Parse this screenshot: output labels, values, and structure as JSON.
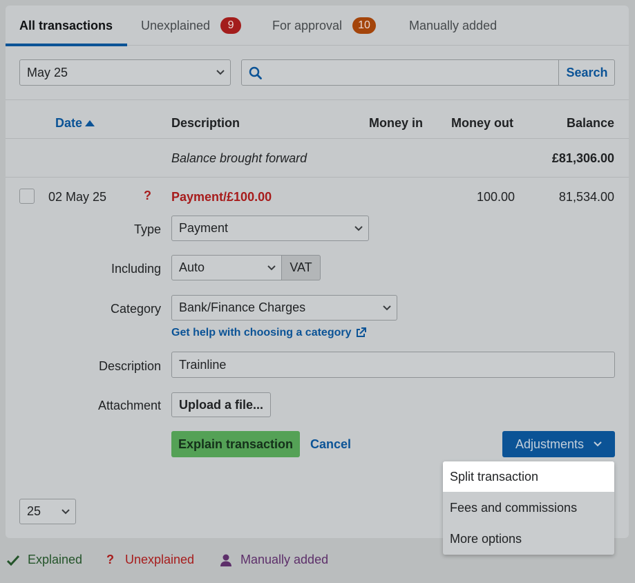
{
  "tabs": [
    {
      "label": "All transactions"
    },
    {
      "label": "Unexplained",
      "badge": "9"
    },
    {
      "label": "For approval",
      "badge": "10"
    },
    {
      "label": "Manually added"
    }
  ],
  "filters": {
    "month": "May 25",
    "search_value": "",
    "search_button": "Search"
  },
  "table": {
    "columns": {
      "date": "Date",
      "description": "Description",
      "money_in": "Money in",
      "money_out": "Money out",
      "balance": "Balance"
    },
    "brought_forward": {
      "description": "Balance brought forward",
      "balance": "£81,306.00"
    },
    "row": {
      "date": "02 May 25",
      "status_glyph": "?",
      "description": "Payment/£100.00",
      "money_out": "100.00",
      "balance": "81,534.00"
    }
  },
  "form": {
    "type_label": "Type",
    "type_value": "Payment",
    "including_label": "Including",
    "including_value": "Auto",
    "vat_label": "VAT",
    "category_label": "Category",
    "category_value": "Bank/Finance Charges",
    "category_help": "Get help with choosing a category",
    "description_label": "Description",
    "description_value": "Trainline",
    "attachment_label": "Attachment",
    "upload_button": "Upload a file..."
  },
  "actions": {
    "explain": "Explain transaction",
    "cancel": "Cancel",
    "adjustments": "Adjustments"
  },
  "adjustments_menu": [
    {
      "label": "Split transaction"
    },
    {
      "label": "Fees and commissions"
    },
    {
      "label": "More options"
    }
  ],
  "pagination": {
    "per_page": "25"
  },
  "legend": {
    "explained": "Explained",
    "unexplained": "Unexplained",
    "manually_added": "Manually added"
  },
  "colors": {
    "brand_blue": "#0b5396",
    "explain_green": "#54a156",
    "unexplained_red": "#a71c1c",
    "badge_red": "#a31d1c",
    "badge_orange": "#a4450b",
    "manual_purple": "#5d2f6a"
  }
}
